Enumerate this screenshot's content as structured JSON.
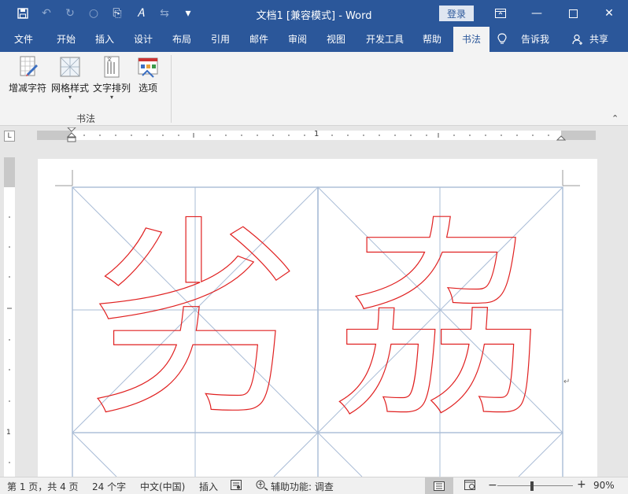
{
  "app": {
    "title": "文档1 [兼容模式]  -  Word",
    "login_label": "登录"
  },
  "tabs": [
    {
      "label": "文件"
    },
    {
      "label": "开始"
    },
    {
      "label": "插入"
    },
    {
      "label": "设计"
    },
    {
      "label": "布局"
    },
    {
      "label": "引用"
    },
    {
      "label": "邮件"
    },
    {
      "label": "审阅"
    },
    {
      "label": "视图"
    },
    {
      "label": "开发工具"
    },
    {
      "label": "帮助"
    },
    {
      "label": "书法"
    },
    {
      "label": "告诉我"
    },
    {
      "label": "共享"
    }
  ],
  "ribbon": {
    "buttons": [
      {
        "label": "增减字符"
      },
      {
        "label": "网格样式"
      },
      {
        "label": "文字排列"
      },
      {
        "label": "选项"
      }
    ],
    "group_label": "书法"
  },
  "ruler": {
    "mark": "1"
  },
  "document": {
    "chars": [
      "劣",
      "劦"
    ],
    "accent_color": "#e02020",
    "grid_color": "#a9bcd6"
  },
  "status": {
    "page": "第 1 页，共 4 页",
    "words": "24 个字",
    "language": "中文(中国)",
    "mode": "插入",
    "accessibility": "辅助功能: 调查",
    "zoom": "90%"
  }
}
